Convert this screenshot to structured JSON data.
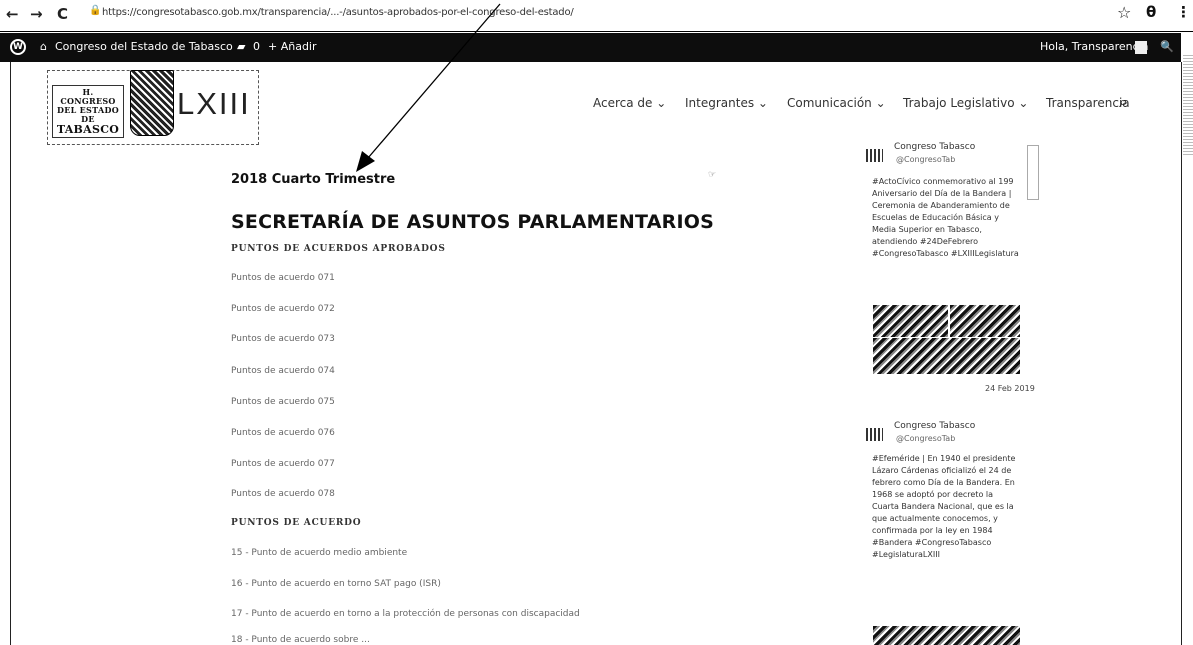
{
  "browser": {
    "back": "←",
    "forward": "→",
    "reload": "C",
    "lock": "🔒",
    "url": "https://congresotabasco.gob.mx/transparencia/...-/asuntos-aprobados-por-el-congreso-del-estado/",
    "star": "☆",
    "profile": "θ",
    "menu": "⋮"
  },
  "admin_bar": {
    "wp_logo": "W",
    "site_name": "Congreso del Estado de Tabasco",
    "comments_count": "0",
    "new_label": "+ Añadir",
    "greeting": "Hola, Transparencia",
    "search": "🔍"
  },
  "logo": {
    "line1": "H. CONGRESO",
    "line2": "DEL ESTADO DE",
    "line3": "TABASCO",
    "legislature": "LXIII"
  },
  "nav": {
    "items": [
      "Acerca de ⌄",
      "Integrantes ⌄",
      "Comunicación ⌄",
      "Trabajo Legislativo ⌄",
      "Transparencia"
    ],
    "search_icon": "⌕"
  },
  "content": {
    "period": "2018 Cuarto Trimestre",
    "section_title": "SECRETARÍA DE ASUNTOS PARLAMENTARIOS",
    "group1_heading": "PUNTOS DE ACUERDOS APROBADOS",
    "group1_links": [
      "Puntos de acuerdo 071",
      "Puntos de acuerdo 072",
      "Puntos de acuerdo 073",
      "Puntos de acuerdo 074",
      "Puntos de acuerdo 075",
      "Puntos de acuerdo 076",
      "Puntos de acuerdo 077",
      "Puntos de acuerdo 078"
    ],
    "group2_heading": "PUNTOS DE ACUERDO",
    "group2_links": [
      "15 - Punto de acuerdo  medio ambiente",
      "16 - Punto de acuerdo en torno SAT pago (ISR)",
      "17 - Punto de acuerdo en torno a la protección de personas con discapacidad",
      "18 - Punto de acuerdo  sobre ..."
    ]
  },
  "sidebar": {
    "tweet1": {
      "name": "Congreso Tabasco",
      "handle": "@CongresoTab",
      "text": "#ActoCívico conmemorativo al 199 Aniversario del Día de la Bandera | Ceremonia de Abanderamiento de Escuelas de Educación Básica y Media Superior en Tabasco, atendiendo #24DeFebrero #CongresoTabasco #LXIIILegislatura"
    },
    "tweet1_date": "24 Feb 2019",
    "tweet2": {
      "name": "Congreso Tabasco",
      "handle": "@CongresoTab",
      "text": "#Efeméride | En 1940 el presidente Lázaro Cárdenas oficializó el 24 de febrero como Día de la Bandera. En 1968 se adoptó por decreto la Cuarta Bandera Nacional, que es la que actualmente conocemos, y confirmada por la ley en 1984 #Bandera #CongresoTabasco #LegislaturaLXIII"
    }
  }
}
